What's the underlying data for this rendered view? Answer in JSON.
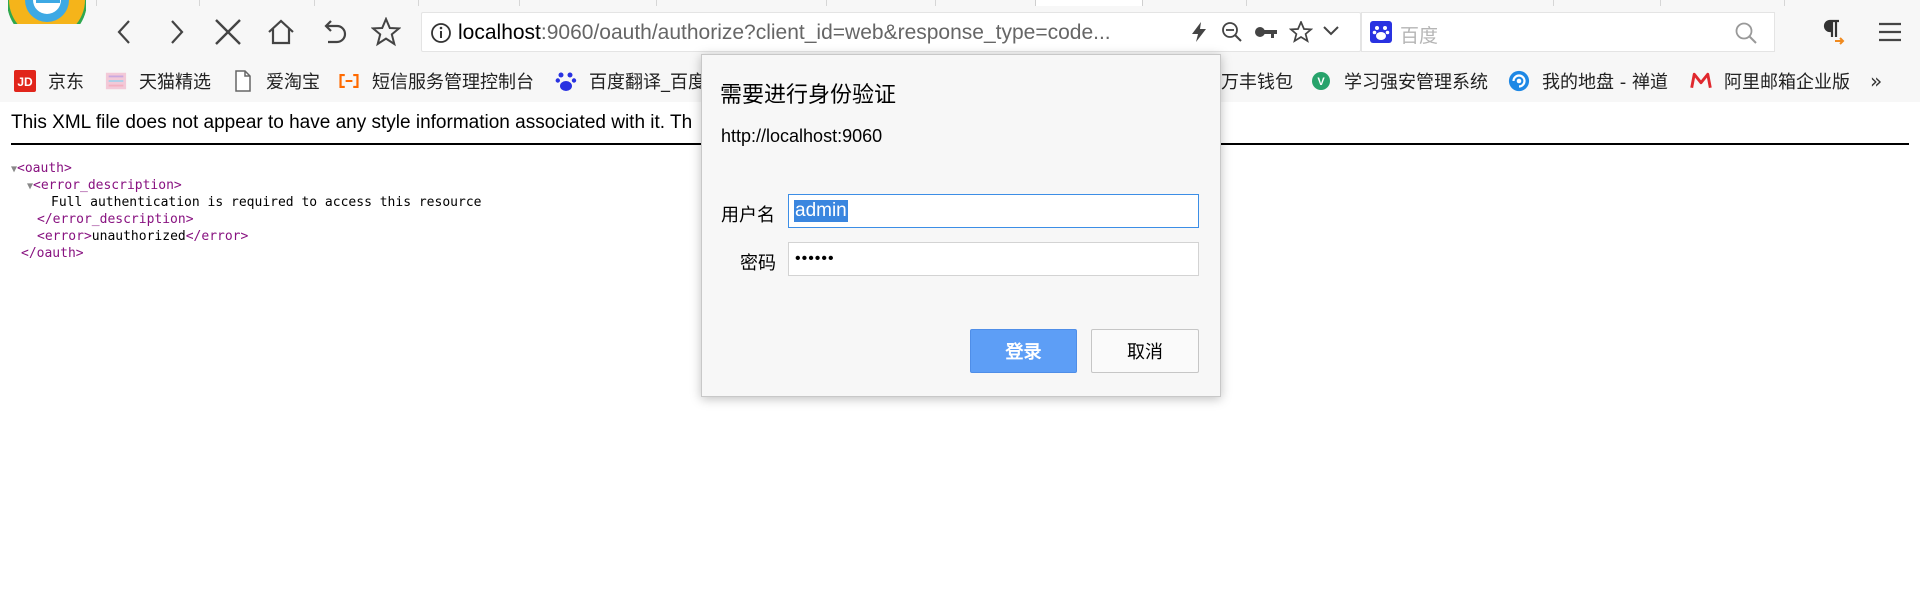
{
  "toolbar": {
    "address": {
      "host": "localhost",
      "rest": ":9060/oauth/authorize?client_id=web&response_type=code..."
    },
    "search_placeholder": "百度"
  },
  "bookmarks": [
    {
      "label": "京东",
      "icon": "jd-icon"
    },
    {
      "label": "天猫精选",
      "icon": "tmall-icon"
    },
    {
      "label": "爱淘宝",
      "icon": "page-icon"
    },
    {
      "label": "短信服务管理控制台",
      "icon": "aliyun-icon"
    },
    {
      "label": "百度翻译_百度",
      "icon": "baidu-paw-icon"
    },
    {
      "label": "万丰钱包",
      "icon": ""
    },
    {
      "label": "学习强安管理系统",
      "icon": "vue-icon"
    },
    {
      "label": "我的地盘 - 禅道",
      "icon": "zentao-icon"
    },
    {
      "label": "阿里邮箱企业版",
      "icon": "ali-mail-icon"
    }
  ],
  "bookmarks_more": "»",
  "content": {
    "banner": "This XML file does not appear to have any style information associated with it. Th",
    "xml": {
      "root_open": "<oauth>",
      "desc_open": "<error_description>",
      "desc_text": "Full authentication is required to access this resource",
      "desc_close": "</error_description>",
      "error_open": "<error>",
      "error_text": "unauthorized",
      "error_close": "</error>",
      "root_close": "</oauth>",
      "triangle": "▼"
    }
  },
  "dialog": {
    "title": "需要进行身份验证",
    "url": "http://localhost:9060",
    "username_label": "用户名",
    "username_value": "admin",
    "password_label": "密码",
    "password_value": "••••••",
    "login_button": "登录",
    "cancel_button": "取消"
  },
  "colors": {
    "tag": "#881280",
    "primary_button": "#5d9ef6",
    "selection": "#3a86df"
  }
}
